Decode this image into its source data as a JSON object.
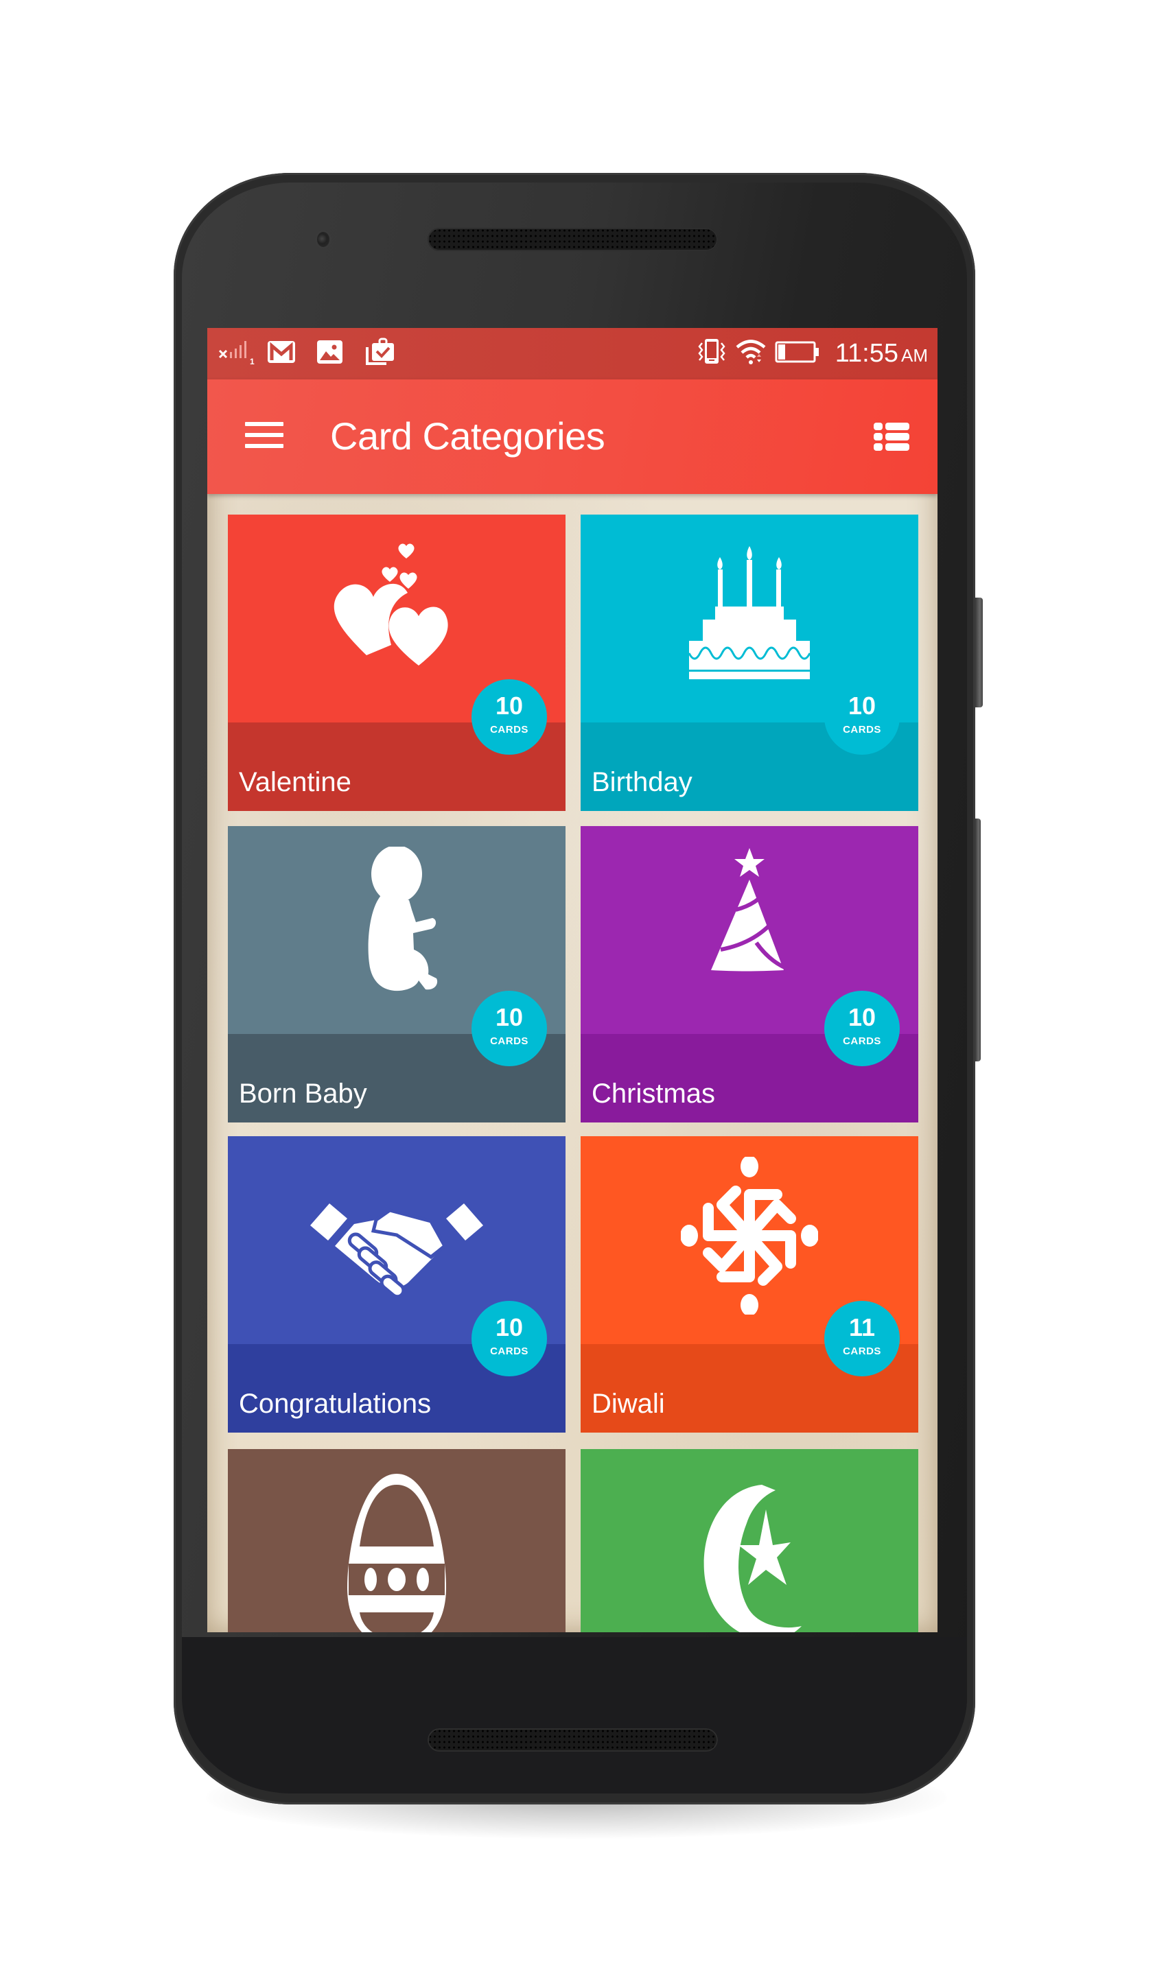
{
  "status_bar": {
    "signal": "no-sim-signal-icon",
    "sim_slot": "1",
    "notifications": [
      "gmail-icon",
      "gallery-icon",
      "clipboard-check-icon"
    ],
    "vibrate": "vibrate-icon",
    "wifi": "wifi-icon",
    "battery_level_percent": 20,
    "time": "11:55",
    "ampm": "AM",
    "color": "#c43a31"
  },
  "app_bar": {
    "title": "Card Categories",
    "menu_icon": "hamburger-menu-icon",
    "view_toggle_icon": "list-view-icon",
    "color": "#f44336"
  },
  "categories": [
    {
      "name": "Valentine",
      "count": "10",
      "unit": "CARDS",
      "icon": "hearts-icon",
      "color": "#f44336",
      "strip_color": "#c5362d"
    },
    {
      "name": "Birthday",
      "count": "10",
      "unit": "CARDS",
      "icon": "birthday-cake-icon",
      "color": "#00bcd4",
      "strip_color": "#00a6bc"
    },
    {
      "name": "Born Baby",
      "count": "10",
      "unit": "CARDS",
      "icon": "baby-icon",
      "color": "#607d8b",
      "strip_color": "#485c68"
    },
    {
      "name": "Christmas",
      "count": "10",
      "unit": "CARDS",
      "icon": "christmas-tree-icon",
      "color": "#9c27b0",
      "strip_color": "#891b9c"
    },
    {
      "name": "Congratulations",
      "count": "10",
      "unit": "CARDS",
      "icon": "handshake-icon",
      "color": "#3f51b5",
      "strip_color": "#2f3f9e"
    },
    {
      "name": "Diwali",
      "count": "11",
      "unit": "CARDS",
      "icon": "swastika-icon",
      "color": "#ff5722",
      "strip_color": "#e64a19"
    },
    {
      "name": "",
      "count": "",
      "unit": "",
      "icon": "easter-egg-icon",
      "color": "#795548",
      "strip_color": "#795548"
    },
    {
      "name": "",
      "count": "",
      "unit": "",
      "icon": "crescent-star-icon",
      "color": "#4caf50",
      "strip_color": "#4caf50"
    }
  ],
  "badge_color": "#00bcd4"
}
